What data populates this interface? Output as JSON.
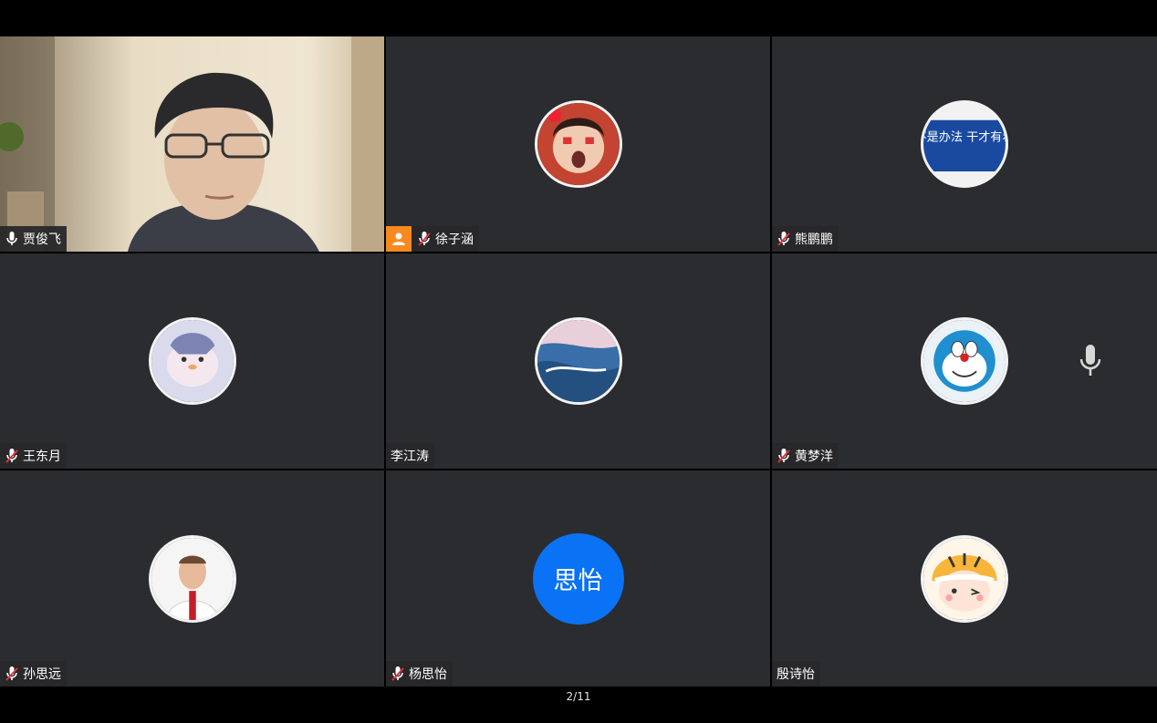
{
  "participants": [
    {
      "name": "贾俊飞",
      "mic": "on"
    },
    {
      "name": "徐子涵",
      "mic": "muted",
      "host": true
    },
    {
      "name": "熊鹏鹏",
      "mic": "muted",
      "avatar_text": "等不是办法 干才有希望"
    },
    {
      "name": "王东月",
      "mic": "muted"
    },
    {
      "name": "李江涛",
      "mic": "none"
    },
    {
      "name": "黄梦洋",
      "mic": "muted"
    },
    {
      "name": "孙思远",
      "mic": "muted"
    },
    {
      "name": "杨思怡",
      "mic": "muted",
      "avatar_text": "思怡"
    },
    {
      "name": "殷诗怡",
      "mic": "none"
    }
  ],
  "page_indicator": "2/11",
  "colors": {
    "tile_bg": "#2b2c2f",
    "host_badge": "#f68a1f",
    "avatar_blue": "#0a72f5",
    "muted_red": "#e0333a"
  }
}
